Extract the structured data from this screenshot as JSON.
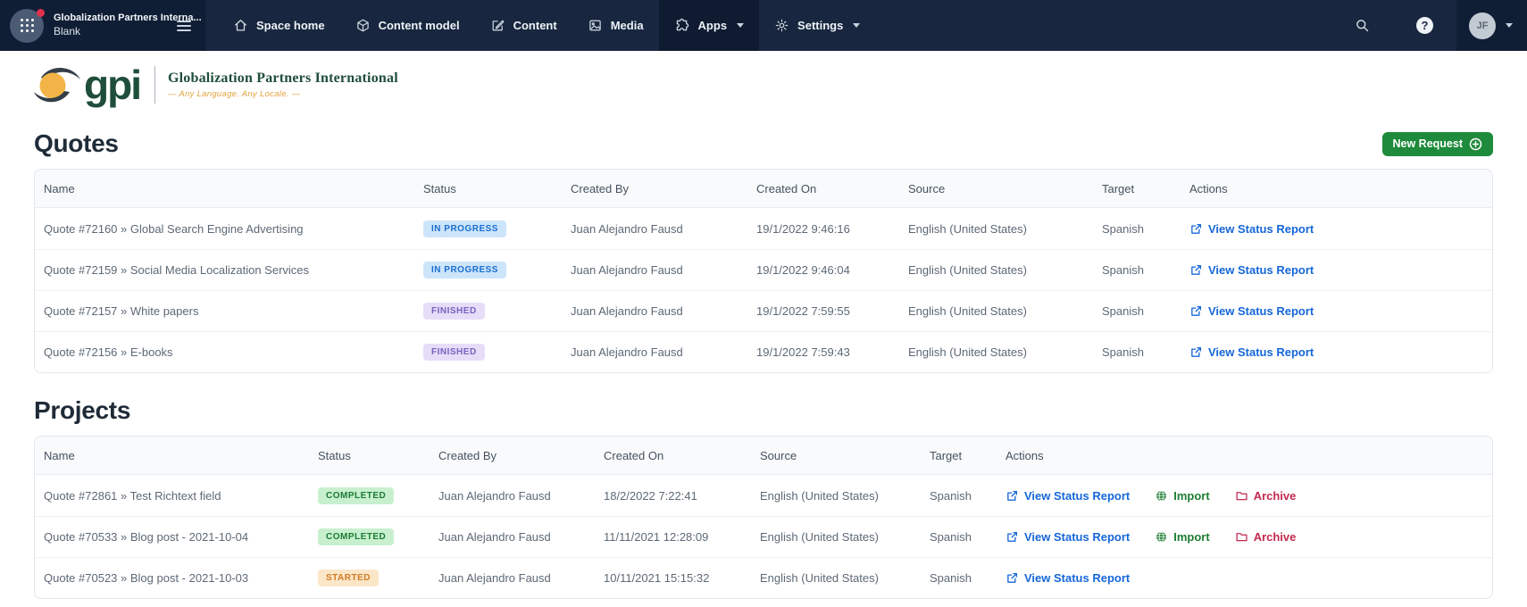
{
  "topbar": {
    "space_name": "Globalization Partners Interna...",
    "environment": "Blank",
    "nav": [
      {
        "label": "Space home"
      },
      {
        "label": "Content model"
      },
      {
        "label": "Content"
      },
      {
        "label": "Media"
      },
      {
        "label": "Apps"
      },
      {
        "label": "Settings"
      }
    ],
    "help_glyph": "?",
    "avatar_initials": "JF"
  },
  "brand": {
    "logo_text": "gpi",
    "company": "Globalization Partners International",
    "tagline": "— Any Language. Any Locale. —"
  },
  "quotes": {
    "title": "Quotes",
    "new_request_label": "New Request",
    "columns": [
      "Name",
      "Status",
      "Created By",
      "Created On",
      "Source",
      "Target",
      "Actions"
    ],
    "rows": [
      {
        "name": "Quote #72160 » Global Search Engine Advertising",
        "status": "IN PROGRESS",
        "status_type": "in-progress",
        "created_by": "Juan Alejandro Fausd",
        "created_on": "19/1/2022 9:46:16",
        "source": "English (United States)",
        "target": "Spanish",
        "actions": [
          "View Status Report"
        ]
      },
      {
        "name": "Quote #72159 » Social Media Localization Services",
        "status": "IN PROGRESS",
        "status_type": "in-progress",
        "created_by": "Juan Alejandro Fausd",
        "created_on": "19/1/2022 9:46:04",
        "source": "English (United States)",
        "target": "Spanish",
        "actions": [
          "View Status Report"
        ]
      },
      {
        "name": "Quote #72157 » White papers",
        "status": "FINISHED",
        "status_type": "finished",
        "created_by": "Juan Alejandro Fausd",
        "created_on": "19/1/2022 7:59:55",
        "source": "English (United States)",
        "target": "Spanish",
        "actions": [
          "View Status Report"
        ]
      },
      {
        "name": "Quote #72156 » E-books",
        "status": "FINISHED",
        "status_type": "finished",
        "created_by": "Juan Alejandro Fausd",
        "created_on": "19/1/2022 7:59:43",
        "source": "English (United States)",
        "target": "Spanish",
        "actions": [
          "View Status Report"
        ]
      }
    ]
  },
  "projects": {
    "title": "Projects",
    "columns": [
      "Name",
      "Status",
      "Created By",
      "Created On",
      "Source",
      "Target",
      "Actions"
    ],
    "rows": [
      {
        "name": "Quote #72861 » Test Richtext field",
        "status": "COMPLETED",
        "status_type": "completed",
        "created_by": "Juan Alejandro Fausd",
        "created_on": "18/2/2022 7:22:41",
        "source": "English (United States)",
        "target": "Spanish",
        "actions": [
          "View Status Report",
          "Import",
          "Archive"
        ]
      },
      {
        "name": "Quote #70533 » Blog post - 2021-10-04",
        "status": "COMPLETED",
        "status_type": "completed",
        "created_by": "Juan Alejandro Fausd",
        "created_on": "11/11/2021 12:28:09",
        "source": "English (United States)",
        "target": "Spanish",
        "actions": [
          "View Status Report",
          "Import",
          "Archive"
        ]
      },
      {
        "name": "Quote #70523 » Blog post - 2021-10-03",
        "status": "STARTED",
        "status_type": "started",
        "created_by": "Juan Alejandro Fausd",
        "created_on": "10/11/2021 15:15:32",
        "source": "English (United States)",
        "target": "Spanish",
        "actions": [
          "View Status Report"
        ]
      }
    ]
  },
  "colors": {
    "topbar_bg": "#18273f",
    "accent_green": "#1e8a3b",
    "link_blue": "#1667d9",
    "import_green": "#1d7d33",
    "archive_red": "#c32a4e",
    "badge_in_progress_bg": "#cde5fa",
    "badge_in_progress_fg": "#1b6fd0",
    "badge_finished_bg": "#e6def8",
    "badge_finished_fg": "#7a5fc0",
    "badge_completed_bg": "#c8f0cf",
    "badge_completed_fg": "#1b7a33",
    "badge_started_bg": "#fbe6c8",
    "badge_started_fg": "#d07a24"
  }
}
